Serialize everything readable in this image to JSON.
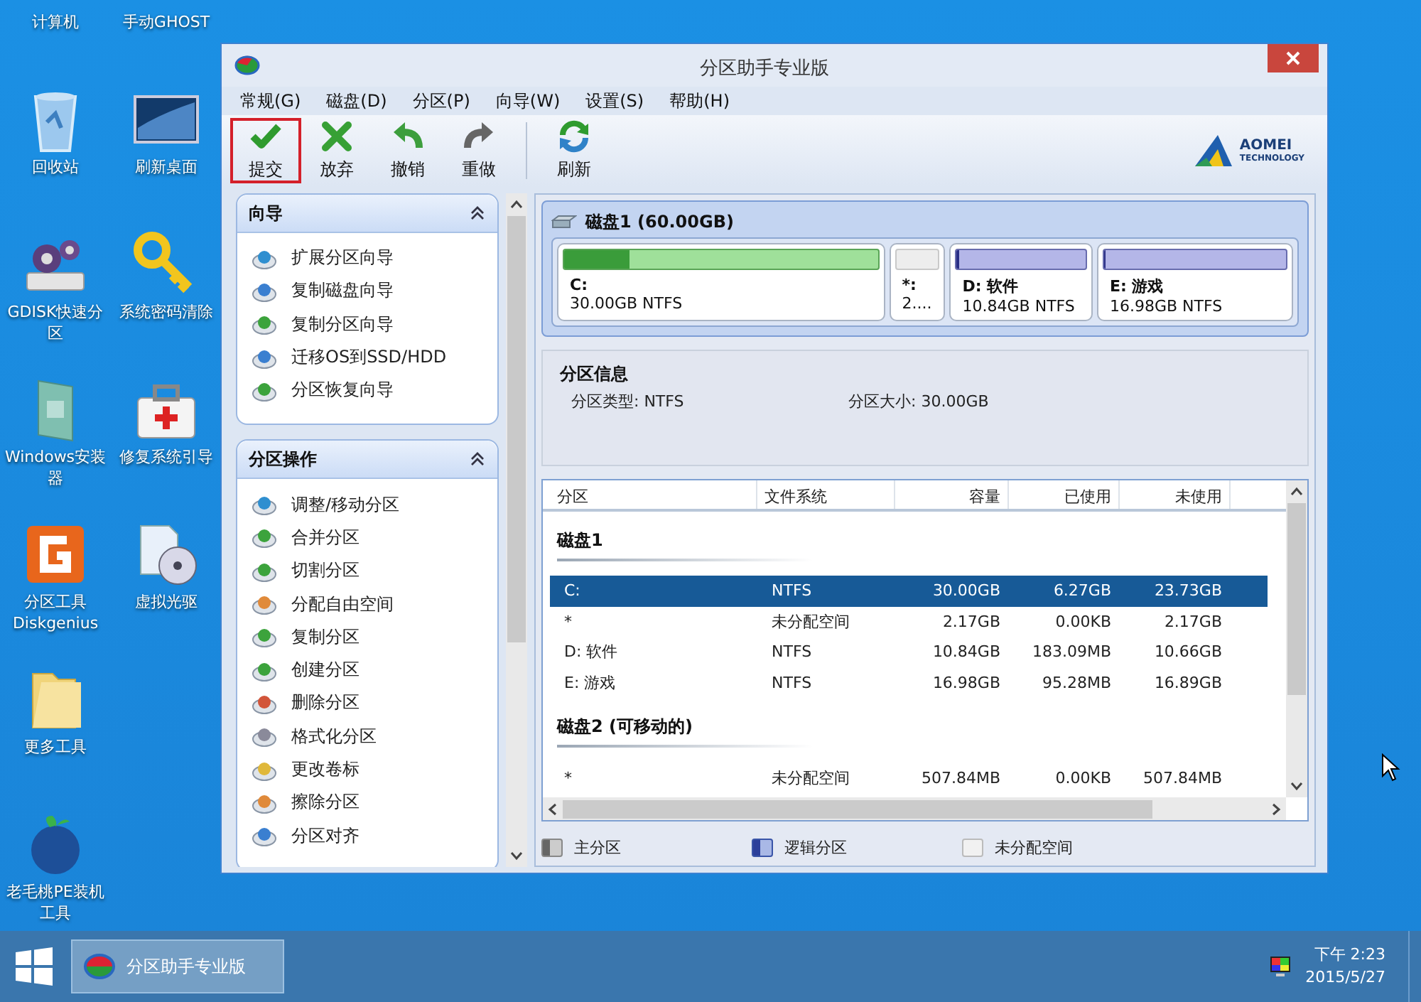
{
  "desktop_columns": [
    [
      {
        "label": "计算机",
        "kind": "computer"
      },
      {
        "label": "回收站",
        "kind": "recycle"
      },
      {
        "label": "GDISK快速分区",
        "kind": "gears"
      },
      {
        "label": "Windows安装器",
        "kind": "installer"
      },
      {
        "label": "分区工具Diskgenius",
        "kind": "diskgenius"
      },
      {
        "label": "更多工具",
        "kind": "folder"
      },
      {
        "label": "老毛桃PE装机工具",
        "kind": "peach"
      }
    ],
    [
      {
        "label": "手动GHOST",
        "kind": "ghost"
      },
      {
        "label": "刷新桌面",
        "kind": "monitor"
      },
      {
        "label": "系统密码清除",
        "kind": "key"
      },
      {
        "label": "修复系统引导",
        "kind": "medkit"
      },
      {
        "label": "虚拟光驱",
        "kind": "disc"
      }
    ]
  ],
  "window": {
    "title": "分区助手专业版"
  },
  "menu": [
    "常规(G)",
    "磁盘(D)",
    "分区(P)",
    "向导(W)",
    "设置(S)",
    "帮助(H)"
  ],
  "toolbar": [
    {
      "label": "提交",
      "kind": "check",
      "marked": true,
      "separator_before": false
    },
    {
      "label": "放弃",
      "kind": "cross",
      "marked": false,
      "separator_before": false
    },
    {
      "label": "撤销",
      "kind": "undo",
      "marked": false,
      "separator_before": false
    },
    {
      "label": "重做",
      "kind": "redo",
      "marked": false,
      "separator_before": false
    },
    {
      "label": "刷新",
      "kind": "refresh",
      "marked": false,
      "separator_before": true
    }
  ],
  "logo": {
    "name": "AOMEI",
    "tagline": "TECHNOLOGY"
  },
  "sidebar": [
    {
      "title": "向导",
      "expanded": true,
      "items": [
        {
          "label": "扩展分区向导",
          "kind": "extend"
        },
        {
          "label": "复制磁盘向导",
          "kind": "clone"
        },
        {
          "label": "复制分区向导",
          "kind": "copy"
        },
        {
          "label": "迁移OS到SSD/HDD",
          "kind": "clone"
        },
        {
          "label": "分区恢复向导",
          "kind": "recover"
        }
      ]
    },
    {
      "title": "分区操作",
      "expanded": true,
      "items": [
        {
          "label": "调整/移动分区",
          "kind": "extend"
        },
        {
          "label": "合并分区",
          "kind": "copy"
        },
        {
          "label": "切割分区",
          "kind": "copy"
        },
        {
          "label": "分配自由空间",
          "kind": "allocate"
        },
        {
          "label": "复制分区",
          "kind": "copy"
        },
        {
          "label": "创建分区",
          "kind": "recover"
        },
        {
          "label": "删除分区",
          "kind": "delete"
        },
        {
          "label": "格式化分区",
          "kind": "format"
        },
        {
          "label": "更改卷标",
          "kind": "label"
        },
        {
          "label": "擦除分区",
          "kind": "allocate"
        },
        {
          "label": "分区对齐",
          "kind": "clone"
        }
      ]
    }
  ],
  "disk_map": {
    "title": "磁盘1 (60.00GB)",
    "partitions": [
      {
        "label": "C:",
        "detail": "30.00GB NTFS",
        "kind": "primary",
        "level": 0.21
      },
      {
        "label": "*:",
        "detail": "2....",
        "kind": "unallocated"
      },
      {
        "label": "D: 软件",
        "detail": "10.84GB NTFS",
        "kind": "logical",
        "level": 0.02
      },
      {
        "label": "E: 游戏",
        "detail": "16.98GB NTFS",
        "kind": "logical",
        "level": 0.01
      }
    ]
  },
  "partition_info": {
    "title": "分区信息",
    "fields": [
      "分区类型: NTFS",
      "分区大小: 30.00GB"
    ]
  },
  "table": {
    "columns": [
      "分区",
      "文件系统",
      "容量",
      "已使用",
      "未使用"
    ],
    "groups": [
      {
        "title": "磁盘1",
        "rows": [
          {
            "cells": [
              "C:",
              "NTFS",
              "30.00GB",
              "6.27GB",
              "23.73GB"
            ],
            "selected": true
          },
          {
            "cells": [
              "*",
              "未分配空间",
              "2.17GB",
              "0.00KB",
              "2.17GB"
            ],
            "selected": false
          },
          {
            "cells": [
              "D: 软件",
              "NTFS",
              "10.84GB",
              "183.09MB",
              "10.66GB"
            ],
            "selected": false
          },
          {
            "cells": [
              "E: 游戏",
              "NTFS",
              "16.98GB",
              "95.28MB",
              "16.89GB"
            ],
            "selected": false
          }
        ]
      },
      {
        "title": "磁盘2 (可移动的)",
        "rows": [
          {
            "cells": [
              "*",
              "未分配空间",
              "507.84MB",
              "0.00KB",
              "507.84MB"
            ],
            "selected": false
          }
        ]
      }
    ]
  },
  "legend": [
    {
      "label": "主分区",
      "kind": "primary"
    },
    {
      "label": "逻辑分区",
      "kind": "logical"
    },
    {
      "label": "未分配空间",
      "kind": "unallocated"
    }
  ],
  "taskbar": {
    "tasks": [
      {
        "label": "分区助手专业版",
        "selected": true
      }
    ],
    "time": "下午 2:23",
    "date": "2015/5/27"
  }
}
